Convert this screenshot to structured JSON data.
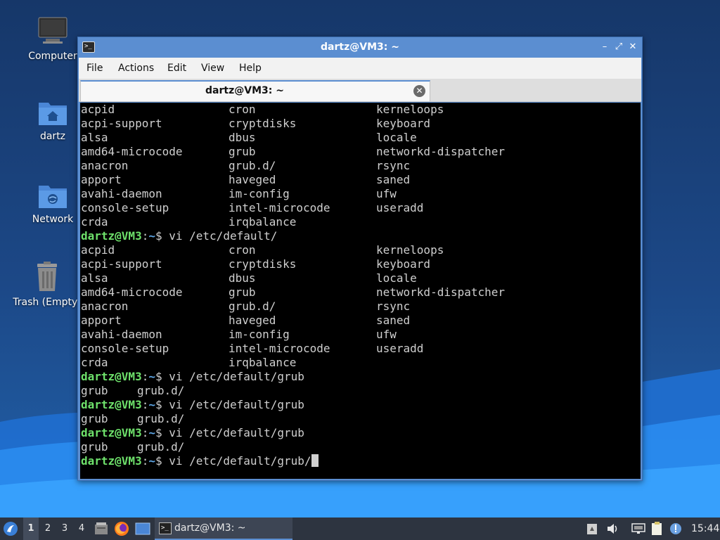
{
  "desktop": {
    "icons": [
      {
        "label": "Computer",
        "icon": "computer-icon"
      },
      {
        "label": "dartz",
        "icon": "home-folder-icon"
      },
      {
        "label": "Network",
        "icon": "network-folder-icon"
      },
      {
        "label": "Trash (Empty)",
        "icon": "trash-icon"
      }
    ]
  },
  "window": {
    "title": "dartz@VM3: ~",
    "minimize_glyph": "–",
    "maximize_glyph": "⤢",
    "close_glyph": "✕",
    "menu": [
      "File",
      "Actions",
      "Edit",
      "View",
      "Help"
    ],
    "tab_label": "dartz@VM3: ~",
    "tab_close_glyph": "✕"
  },
  "terminal": {
    "listing": [
      [
        "acpid",
        "cron",
        "kerneloops"
      ],
      [
        "acpi-support",
        "cryptdisks",
        "keyboard"
      ],
      [
        "alsa",
        "dbus",
        "locale"
      ],
      [
        "amd64-microcode",
        "grub",
        "networkd-dispatcher"
      ],
      [
        "anacron",
        "grub.d/",
        "rsync"
      ],
      [
        "apport",
        "haveged",
        "saned"
      ],
      [
        "avahi-daemon",
        "im-config",
        "ufw"
      ],
      [
        "console-setup",
        "intel-microcode",
        "useradd"
      ],
      [
        "crda",
        "irqbalance",
        ""
      ]
    ],
    "prompt_user": "dartz@VM3",
    "prompt_sep": ":",
    "prompt_path": "~",
    "prompt_dollar": "$ ",
    "cmd1": "vi /etc/default/",
    "cmd2": "vi /etc/default/grub",
    "cmd3": "vi /etc/default/grub",
    "cmd4": "vi /etc/default/grub",
    "cmd5": "vi /etc/default/grub/",
    "completion": [
      "grub",
      "grub.d/"
    ]
  },
  "taskbar": {
    "workspaces": [
      "1",
      "2",
      "3",
      "4"
    ],
    "active_workspace": "1",
    "task_label": "dartz@VM3: ~",
    "clock": "15:44"
  },
  "colors": {
    "titlebar": "#5b8ed1",
    "prompt_user": "#6ee16b",
    "prompt_path": "#5fa8e8",
    "terminal_bg": "#000000",
    "taskbar_bg": "#2d3440"
  }
}
